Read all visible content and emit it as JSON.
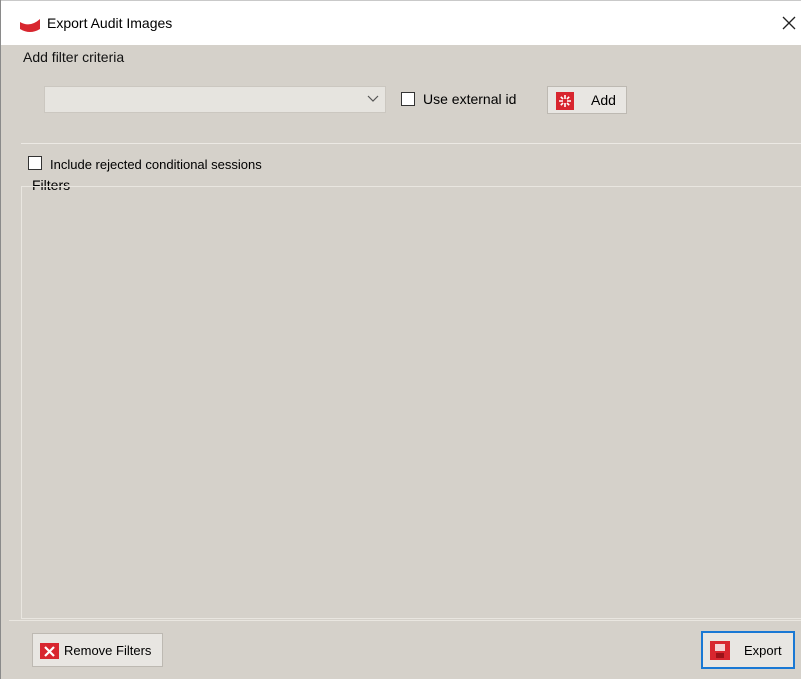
{
  "window": {
    "title": "Export Audit Images",
    "close_symbol": "✕",
    "app_icon": "app-logo-icon"
  },
  "filter_criteria": {
    "section_label": "Add filter criteria",
    "combo_value": "",
    "combo_icon": "chevron-down-icon",
    "use_external_id_label": "Use external id",
    "use_external_id_checked": false,
    "add_label": "Add",
    "add_icon": "add-filter-icon"
  },
  "options": {
    "include_rejected_label": "Include rejected conditional sessions",
    "include_rejected_checked": false
  },
  "filters": {
    "section_label": "Filters",
    "items": []
  },
  "footer": {
    "remove_filters_label": "Remove Filters",
    "remove_icon": "remove-x-icon",
    "export_label": "Export",
    "export_icon": "save-disk-icon"
  },
  "colors": {
    "background": "#d5d1ca",
    "accent_red": "#d8262f",
    "focus_blue": "#1978d4"
  }
}
